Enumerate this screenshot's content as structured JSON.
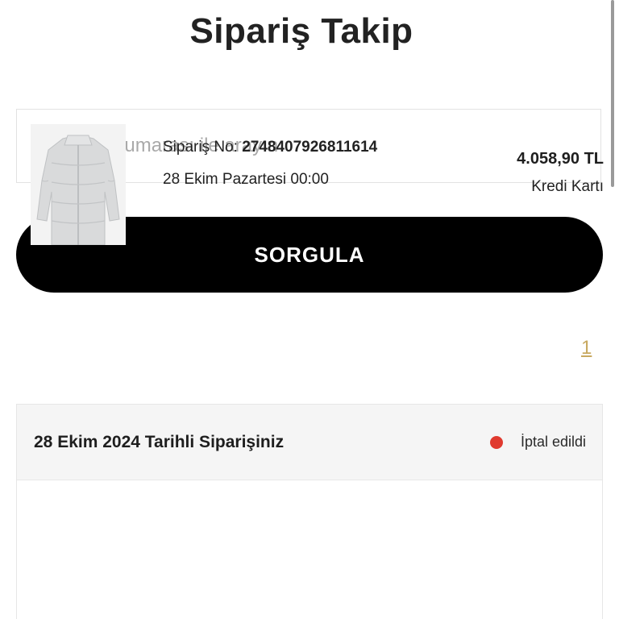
{
  "page": {
    "title": "Sipariş Takip"
  },
  "search": {
    "placeholder": "Sipariş numarası ile arayın",
    "value": ""
  },
  "submit_label": "SORGULA",
  "pagination": {
    "current_page": "1"
  },
  "order": {
    "header_title": "28 Ekim 2024 Tarihli Siparişiniz",
    "status_text": "İptal edildi",
    "status_color": "#e03a2f",
    "order_no_label": "Sipariş No:",
    "order_no_value": "2748407926811614",
    "order_datetime": "28 Ekim Pazartesi 00:00",
    "price": "4.058,90 TL",
    "payment_method": "Kredi Kartı",
    "product_icon": "puffer-jacket-image"
  },
  "colors": {
    "button_bg": "#000000",
    "button_text": "#ffffff",
    "link": "#c8a960",
    "header_bg": "#f5f5f5"
  }
}
